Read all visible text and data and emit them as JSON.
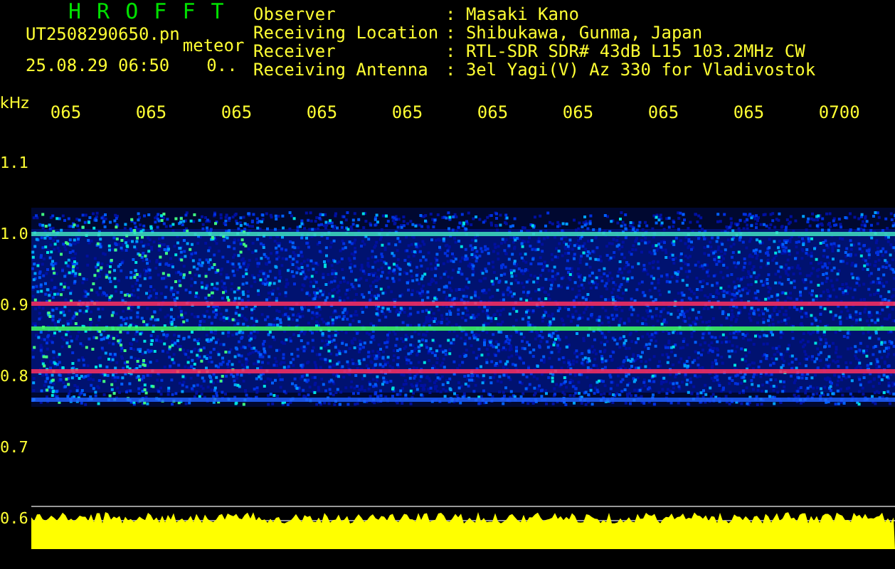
{
  "header": {
    "title": "H R O F F T",
    "file_name": "UT2508290650.pn",
    "mode": "meteor",
    "timestamp": "25.08.29 06:50",
    "count": "0.."
  },
  "station_info": [
    {
      "label": "Observer",
      "value": ": Masaki Kano"
    },
    {
      "label": "Receiving Location",
      "value": ": Shibukawa, Gunma, Japan"
    },
    {
      "label": "Receiver",
      "value": ": RTL-SDR SDR# 43dB L15 103.2MHz CW"
    },
    {
      "label": "Receiving Antenna",
      "value": ": 3el Yagi(V) Az 330 for Vladivostok"
    }
  ],
  "x_axis": {
    "unit": "kHz",
    "labels": [
      "065",
      "065",
      "065",
      "065",
      "065",
      "065",
      "065",
      "065",
      "065",
      "0700"
    ]
  },
  "y_axis": {
    "labels": [
      "1.1",
      "1.0",
      "0.9",
      "0.8",
      "0.7",
      "0.6"
    ]
  }
}
